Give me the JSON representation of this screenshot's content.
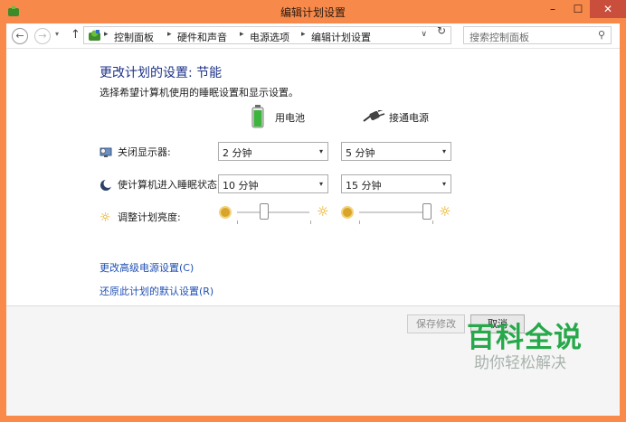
{
  "window": {
    "title": "编辑计划设置",
    "controls": {
      "minimize": "–",
      "maximize": "☐",
      "close": "✕"
    }
  },
  "nav": {
    "back_glyph": "←",
    "forward_glyph": "→",
    "dropdown_glyph": "▾",
    "up_glyph": "↑",
    "breadcrumbs": [
      "控制面板",
      "硬件和声音",
      "电源选项",
      "编辑计划设置"
    ],
    "separator": "▸",
    "address_dropdown_glyph": "∨",
    "refresh_glyph": "↻",
    "search_placeholder": "搜索控制面板",
    "search_glyph": "⚲"
  },
  "main": {
    "heading": "更改计划的设置: 节能",
    "description": "选择希望计算机使用的睡眠设置和显示设置。",
    "columns": {
      "battery": "用电池",
      "plugged": "接通电源"
    },
    "rows": {
      "display_off": {
        "label": "关闭显示器:",
        "battery": "2 分钟",
        "plugged": "5 分钟"
      },
      "sleep": {
        "label": "使计算机进入睡眠状态:",
        "battery": "10 分钟",
        "plugged": "15 分钟"
      },
      "brightness": {
        "label": "调整计划亮度:",
        "battery_level": 0.35,
        "plugged_level": 1.0,
        "sun_glyph": "☼"
      }
    },
    "dropdown_glyph": "▾",
    "links": {
      "advanced": "更改高级电源设置(C)",
      "restore": "还原此计划的默认设置(R)"
    }
  },
  "footer": {
    "save": "保存修改",
    "cancel": "取消"
  },
  "watermark": {
    "title": "百科全说",
    "subtitle": "助你轻松解决"
  },
  "colors": {
    "titlebar": "#f7894a",
    "link": "#1f4fb4",
    "heading": "#1e3287",
    "close_button": "#c94f3c",
    "watermark": "#27a84a"
  }
}
